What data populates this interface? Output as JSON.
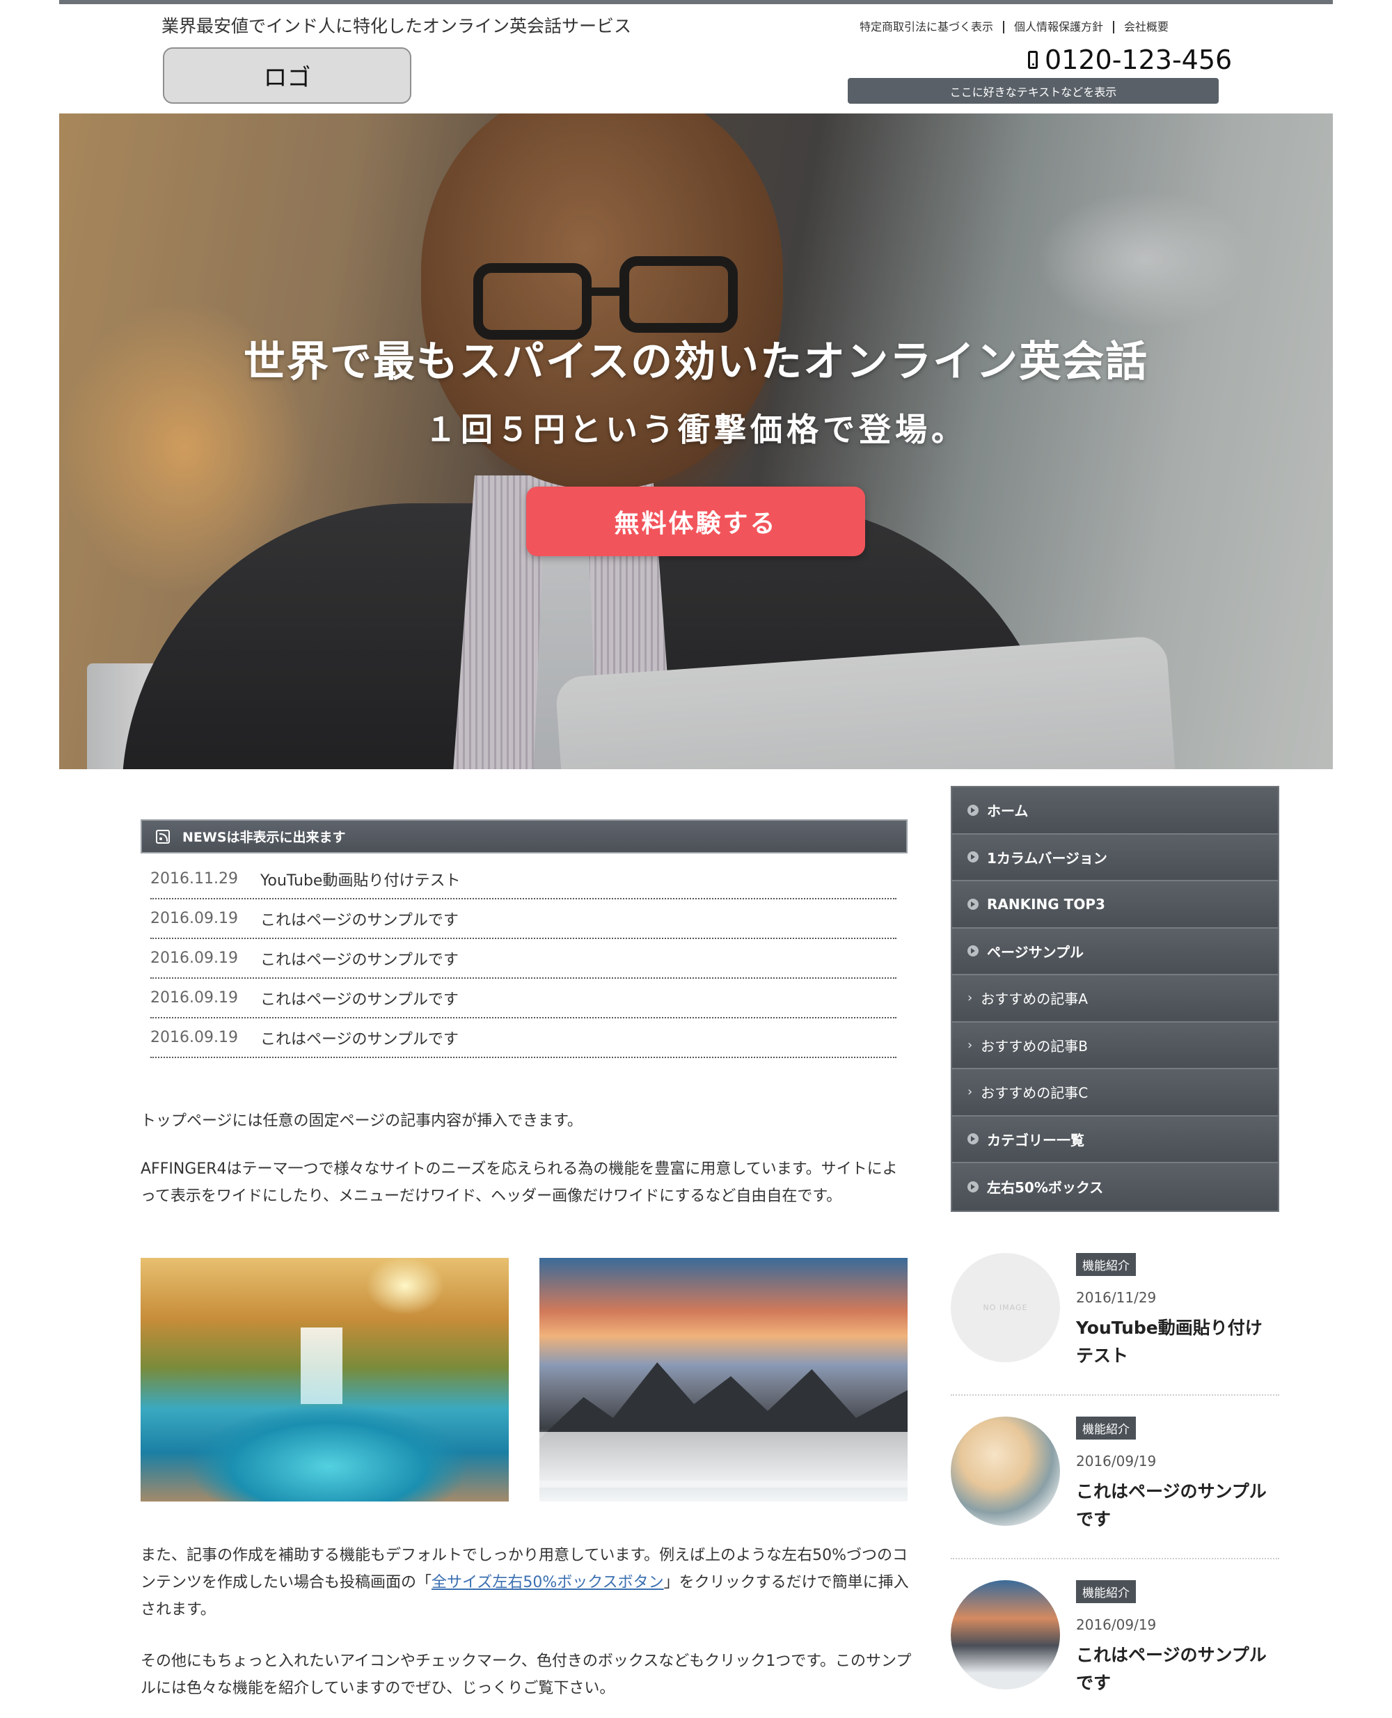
{
  "header": {
    "tagline": "業界最安値でインド人に特化したオンライン英会話サービス",
    "logo": "ロゴ",
    "links": [
      "特定商取引法に基づく表示",
      "個人情報保護方針",
      "会社概要"
    ],
    "phone": "0120-123-456",
    "banner": "ここに好きなテキストなどを表示"
  },
  "hero": {
    "title": "世界で最もスパイスの効いたオンライン英会話",
    "subtitle": "１回５円という衝撃価格で登場。",
    "cta": "無料体験する"
  },
  "news": {
    "heading": "NEWSは非表示に出来ます",
    "items": [
      {
        "date": "2016.11.29",
        "title": "YouTube動画貼り付けテスト"
      },
      {
        "date": "2016.09.19",
        "title": "これはページのサンプルです"
      },
      {
        "date": "2016.09.19",
        "title": "これはページのサンプルです"
      },
      {
        "date": "2016.09.19",
        "title": "これはページのサンプルです"
      },
      {
        "date": "2016.09.19",
        "title": "これはページのサンプルです"
      }
    ]
  },
  "content": {
    "p1": "トップページには任意の固定ページの記事内容が挿入できます。",
    "p2": "AFFINGER4はテーマ一つで様々なサイトのニーズを応えられる為の機能を豊富に用意しています。サイトによって表示をワイドにしたり、メニューだけワイド、ヘッダー画像だけワイドにするなど自由自在です。",
    "p3_before": "また、記事の作成を補助する機能もデフォルトでしっかり用意しています。例えば上のような左右50%づつのコンテンツを作成したい場合も投稿画面の「",
    "p3_link": "全サイズ左右50%ボックスボタン",
    "p3_after": "」をクリックするだけで簡単に挿入されます。",
    "p4": "その他にもちょっと入れたいアイコンやチェックマーク、色付きのボックスなどもクリック1つです。このサンプルには色々な機能を紹介していますのでぜひ、じっくりご覧下さい。"
  },
  "sidebar": {
    "menu": [
      {
        "label": "ホーム",
        "type": "main"
      },
      {
        "label": "1カラムバージョン",
        "type": "main"
      },
      {
        "label": "RANKING TOP3",
        "type": "main"
      },
      {
        "label": "ページサンプル",
        "type": "main"
      },
      {
        "label": "おすすめの記事A",
        "type": "sub"
      },
      {
        "label": "おすすめの記事B",
        "type": "sub"
      },
      {
        "label": "おすすめの記事C",
        "type": "sub"
      },
      {
        "label": "カテゴリー一覧",
        "type": "main"
      },
      {
        "label": "左右50%ボックス",
        "type": "main"
      }
    ],
    "posts": [
      {
        "badge": "機能紹介",
        "date": "2016/11/29",
        "title": "YouTube動画貼り付けテスト",
        "thumb": "NO IMAGE"
      },
      {
        "badge": "機能紹介",
        "date": "2016/09/19",
        "title": "これはページのサンプルです"
      },
      {
        "badge": "機能紹介",
        "date": "2016/09/19",
        "title": "これはページのサンプルです"
      }
    ]
  },
  "colors": {
    "accent_cta": "#f2545b",
    "bar_gray": "#4b5157",
    "link": "#3a6fb0"
  }
}
